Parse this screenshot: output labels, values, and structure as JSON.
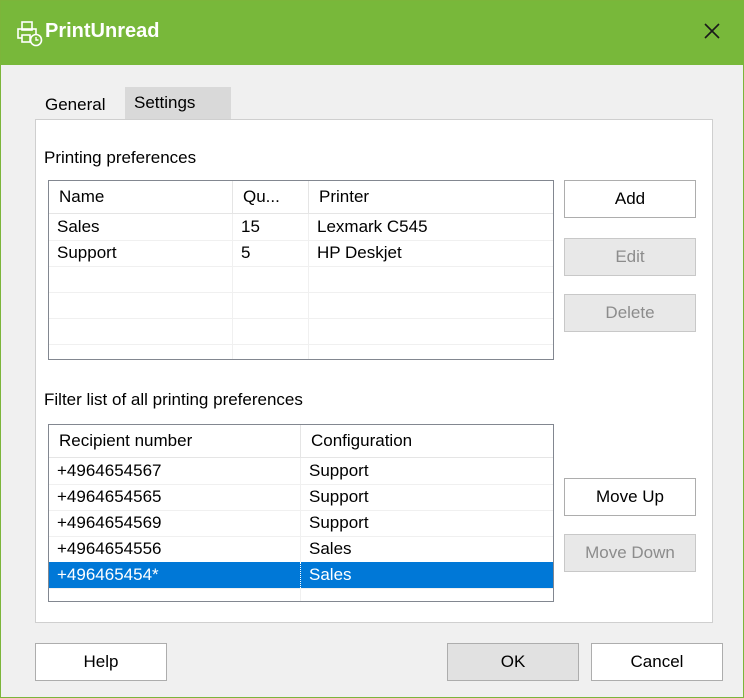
{
  "window": {
    "title": "PrintUnread",
    "close_glyph": "✕"
  },
  "tabs": [
    {
      "label": "General",
      "active": false
    },
    {
      "label": "Settings",
      "active": true
    }
  ],
  "printing_preferences": {
    "label": "Printing preferences",
    "columns": [
      "Name",
      "Qu...",
      "Printer"
    ],
    "rows": [
      [
        "Sales",
        "15",
        "Lexmark C545"
      ],
      [
        "Support",
        "5",
        "HP Deskjet"
      ]
    ],
    "buttons": {
      "add": "Add",
      "edit": "Edit",
      "delete": "Delete"
    }
  },
  "filter_list": {
    "label": "Filter list of all printing preferences",
    "columns": [
      "Recipient number",
      "Configuration"
    ],
    "rows": [
      [
        "+4964654567",
        "Support"
      ],
      [
        "+4964654565",
        "Support"
      ],
      [
        "+4964654569",
        "Support"
      ],
      [
        "+4964654556",
        "Sales"
      ],
      [
        "+496465454*",
        "Sales"
      ]
    ],
    "selected_row": 4,
    "buttons": {
      "move_up": "Move Up",
      "move_down": "Move Down"
    }
  },
  "footer": {
    "help": "Help",
    "ok": "OK",
    "cancel": "Cancel"
  },
  "colors": {
    "titlebar": "#78b83a",
    "selection": "#0078d7"
  },
  "icons": {
    "app": "printer-clock-icon",
    "close": "close-icon"
  }
}
